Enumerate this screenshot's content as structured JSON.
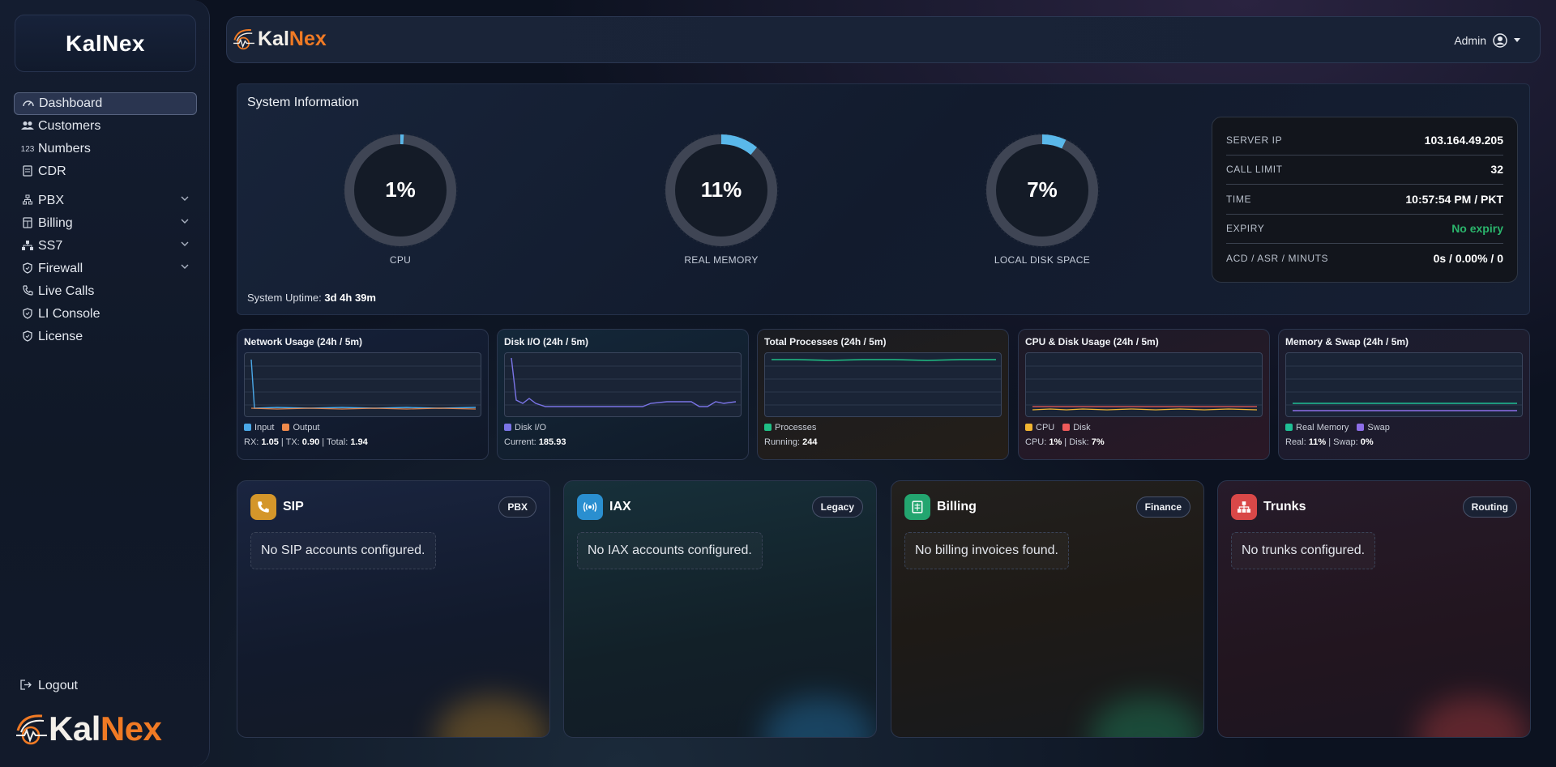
{
  "sidebar": {
    "brand": "KalNex",
    "items": [
      {
        "label": "Dashboard",
        "icon": "gauge-icon"
      },
      {
        "label": "Customers",
        "icon": "users-icon"
      },
      {
        "label": "Numbers",
        "icon": "numbers-icon",
        "icon_text": "123"
      },
      {
        "label": "CDR",
        "icon": "document-icon"
      },
      {
        "label": "PBX",
        "icon": "pbx-icon"
      },
      {
        "label": "Billing",
        "icon": "billing-icon"
      },
      {
        "label": "SS7",
        "icon": "network-icon"
      },
      {
        "label": "Firewall",
        "icon": "shield-icon"
      },
      {
        "label": "Live Calls",
        "icon": "phone-icon"
      },
      {
        "label": "LI Console",
        "icon": "shield-icon"
      },
      {
        "label": "License",
        "icon": "license-icon"
      }
    ],
    "logout": "Logout",
    "logo_kal": "Kal",
    "logo_nex": "Nex"
  },
  "topbar": {
    "logo_kal": "Kal",
    "logo_nex": "Nex",
    "user": "Admin"
  },
  "system": {
    "title": "System Information",
    "gauges": [
      {
        "label": "CPU",
        "value_text": "1%",
        "fraction": 0.01
      },
      {
        "label": "REAL MEMORY",
        "value_text": "11%",
        "fraction": 0.11
      },
      {
        "label": "LOCAL DISK SPACE",
        "value_text": "7%",
        "fraction": 0.07
      }
    ],
    "uptime_label": "System Uptime:",
    "uptime_value": "3d 4h 39m",
    "info": [
      {
        "key": "SERVER IP",
        "value": "103.164.49.205"
      },
      {
        "key": "CALL LIMIT",
        "value": "32"
      },
      {
        "key": "TIME",
        "value": "10:57:54 PM / PKT"
      },
      {
        "key": "EXPIRY",
        "value": "No expiry"
      },
      {
        "key": "ACD / ASR / MINUTS",
        "value": "0s / 0.00% / 0"
      }
    ]
  },
  "minis": [
    {
      "title": "Network Usage (24h / 5m)",
      "legend": [
        {
          "label": "Input",
          "color": "#4aa8e8"
        },
        {
          "label": "Output",
          "color": "#f08a4b"
        }
      ],
      "stat_parts": [
        "RX: ",
        "1.05",
        " | TX: ",
        "0.90",
        " | Total: ",
        "1.94"
      ]
    },
    {
      "title": "Disk I/O (24h / 5m)",
      "legend": [
        {
          "label": "Disk I/O",
          "color": "#7a74e6"
        }
      ],
      "stat_parts": [
        "Current: ",
        "185.93"
      ]
    },
    {
      "title": "Total Processes (24h / 5m)",
      "legend": [
        {
          "label": "Processes",
          "color": "#1fbf85"
        }
      ],
      "stat_parts": [
        "Running: ",
        "244"
      ]
    },
    {
      "title": "CPU & Disk Usage (24h / 5m)",
      "legend": [
        {
          "label": "CPU",
          "color": "#f2b531"
        },
        {
          "label": "Disk",
          "color": "#ef5a5a"
        }
      ],
      "stat_parts": [
        "CPU: ",
        "1%",
        " | Disk: ",
        "7%"
      ]
    },
    {
      "title": "Memory & Swap (24h / 5m)",
      "legend": [
        {
          "label": "Real Memory",
          "color": "#1fbf95"
        },
        {
          "label": "Swap",
          "color": "#8d6ee8"
        }
      ],
      "stat_parts": [
        "Real: ",
        "11%",
        " | Swap: ",
        "0%"
      ]
    }
  ],
  "cards": [
    {
      "title": "SIP",
      "tag": "PBX",
      "empty": "No SIP accounts configured.",
      "icon": "phone-icon",
      "color": "#d4962a"
    },
    {
      "title": "IAX",
      "tag": "Legacy",
      "empty": "No IAX accounts configured.",
      "icon": "broadcast-icon",
      "color": "#2a8fd0"
    },
    {
      "title": "Billing",
      "tag": "Finance",
      "empty": "No billing invoices found.",
      "icon": "invoice-icon",
      "color": "#23a56f"
    },
    {
      "title": "Trunks",
      "tag": "Routing",
      "empty": "No trunks configured.",
      "icon": "sitemap-icon",
      "color": "#d94848"
    }
  ]
}
